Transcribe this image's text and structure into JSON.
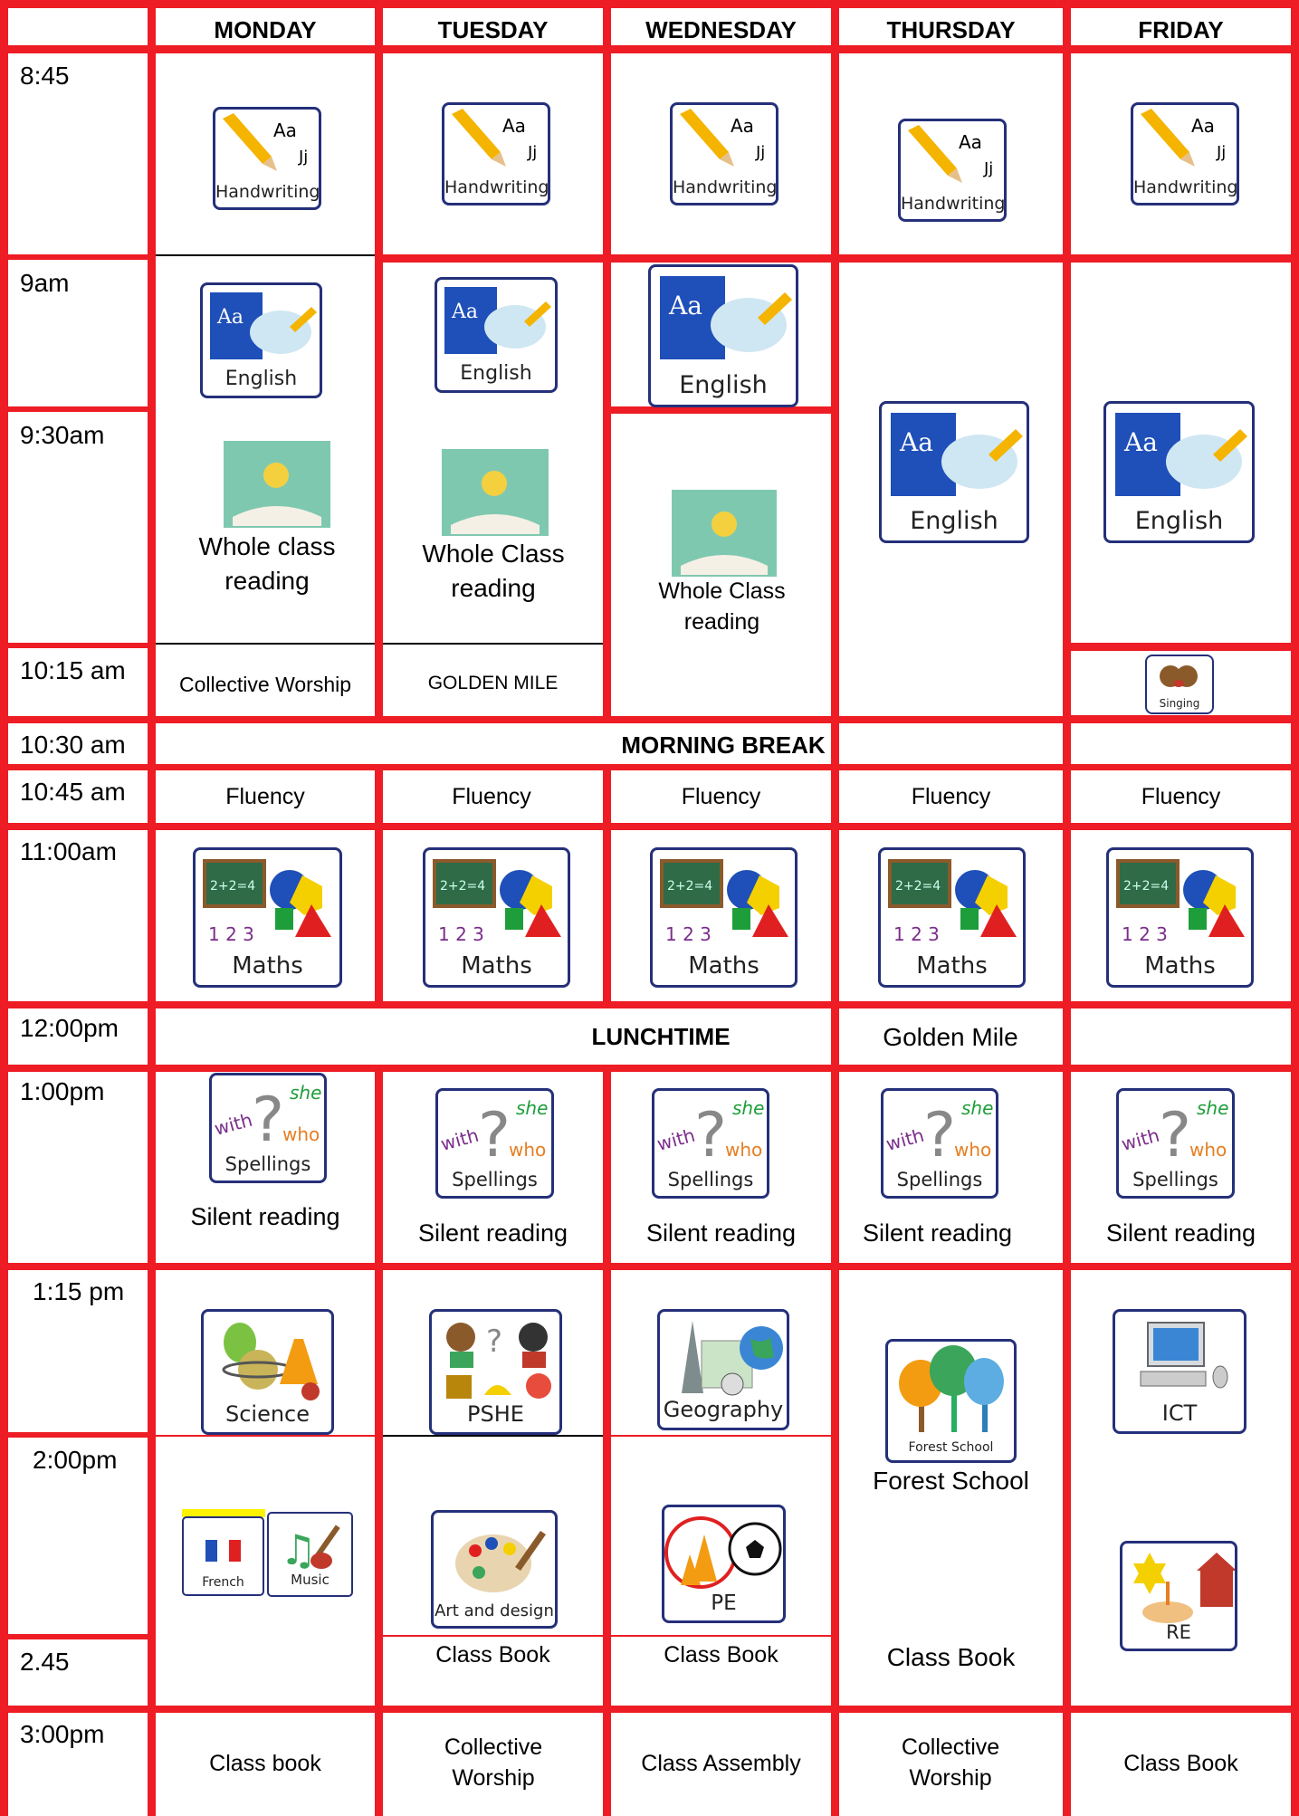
{
  "days": [
    "MONDAY",
    "TUESDAY",
    "WEDNESDAY",
    "THURSDAY",
    "FRIDAY"
  ],
  "times": [
    "8:45",
    "9am",
    "9:30am",
    "10:15 am",
    "10:30 am",
    "10:45 am",
    "11:00am",
    "12:00pm",
    "1:00pm",
    "1:15 pm",
    "2:00pm",
    "2.45",
    "3:00pm"
  ],
  "icons": {
    "handwriting": "Handwriting",
    "english": "English",
    "maths": "Maths",
    "spellings": "Spellings",
    "science": "Science",
    "pshe": "PSHE",
    "geography": "Geography",
    "forest_school": "Forest School",
    "ict": "ICT",
    "french": "French",
    "music": "Music",
    "art": "Art and design",
    "pe": "PE",
    "re": "RE",
    "singing": "Singing",
    "spell_with": "with",
    "spell_she": "she",
    "spell_who": "who",
    "hw_aa": "Aa",
    "hw_jj": "Jj",
    "maths_sum": "2+2=4",
    "maths_123": "1 2 3"
  },
  "text": {
    "whole_class_reading_mon": "Whole class reading",
    "whole_class_reading": "Whole Class reading",
    "collective_worship": "Collective Worship",
    "golden_mile_caps": "GOLDEN MILE",
    "morning_break": "MORNING BREAK",
    "fluency": "Fluency",
    "lunchtime": "LUNCHTIME",
    "golden_mile": "Golden Mile",
    "silent_reading": "Silent reading",
    "forest_school": "Forest School",
    "class_book": "Class Book",
    "class_book_lower": "Class book",
    "class_assembly": "Class Assembly"
  },
  "colors": {
    "grid": "#ee1c24",
    "card_border": "#25307a"
  }
}
